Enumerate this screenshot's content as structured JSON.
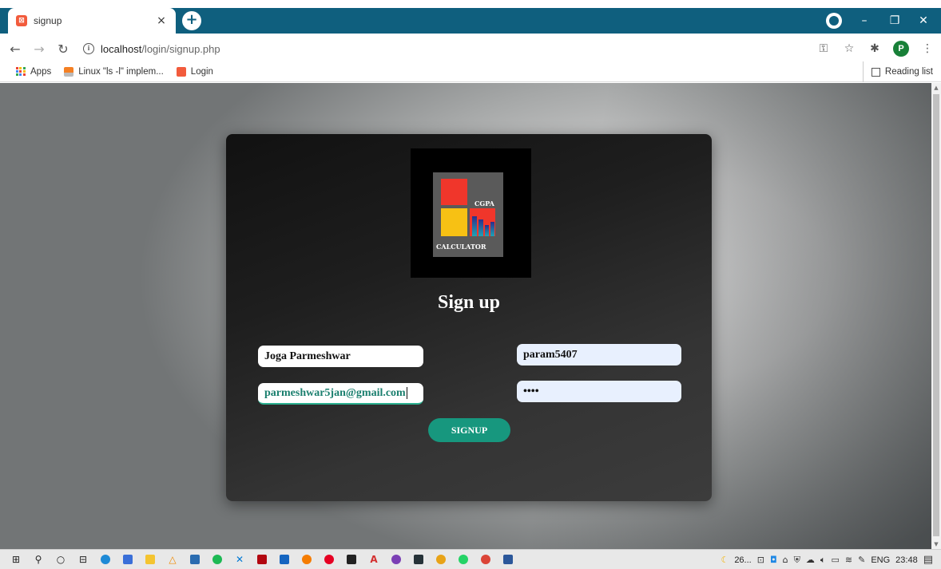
{
  "browser": {
    "tab_title": "signup",
    "tab_close": "×",
    "new_tab": "+",
    "url_host": "localhost",
    "url_path": "/login/signup.php",
    "window_min": "–",
    "window_max": "❐",
    "window_close": "✕",
    "profile_initial": "P",
    "bookmarks": [
      {
        "label": "Apps",
        "icon": "apps-grid-icon"
      },
      {
        "label": "Linux \"ls -l\" implem...",
        "icon": "stackoverflow-icon"
      },
      {
        "label": "Login",
        "icon": "xampp-icon"
      }
    ],
    "reading_list": "Reading list"
  },
  "page": {
    "logo_word_top": "CGPA",
    "logo_word_bottom": "CALCULATOR",
    "title": "Sign up",
    "fields": {
      "full_name": "Joga Parmeshwar",
      "username": "param5407",
      "email": "parmeshwar5jan@gmail.com",
      "password": "••••"
    },
    "submit_label": "SIGNUP"
  },
  "taskbar": {
    "weather": "26...",
    "language": "ENG",
    "time": "23:48"
  },
  "colors": {
    "tabbar": "#0f5f7e",
    "signup_button": "#17977e",
    "logo_red": "#f0362b",
    "logo_yellow": "#f7c114"
  }
}
